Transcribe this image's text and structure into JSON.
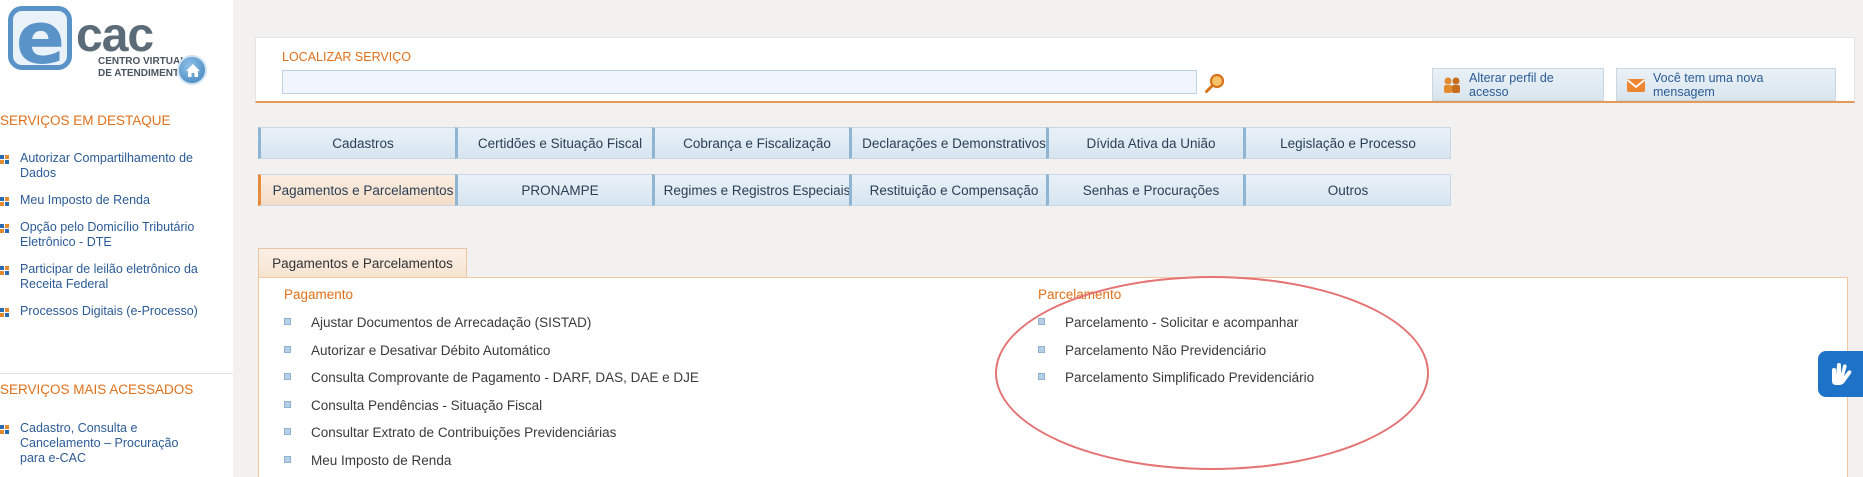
{
  "logo": {
    "brand": "cac",
    "subtitle_line1": "CENTRO VIRTUAL",
    "subtitle_line2": "DE ATENDIMENTO"
  },
  "sidebar": {
    "featured_title": "SERVIÇOS EM DESTAQUE",
    "featured_items": [
      "Autorizar Compartilhamento de Dados",
      "Meu Imposto de Renda",
      "Opção pelo Domicílio Tributário Eletrônico - DTE",
      "Participar de leilão eletrônico da Receita Federal",
      "Processos Digitais (e-Processo)"
    ],
    "most_accessed_title": "SERVIÇOS MAIS ACESSADOS",
    "most_accessed_items": [
      "Cadastro, Consulta e Cancelamento – Procuração para e-CAC"
    ]
  },
  "search": {
    "label": "LOCALIZAR SERVIÇO",
    "value": "",
    "placeholder": ""
  },
  "top_buttons": {
    "profile": "Alterar perfil de acesso",
    "message": "Você tem uma nova mensagem"
  },
  "categories": [
    "Cadastros",
    "Certidões e Situação Fiscal",
    "Cobrança e Fiscalização",
    "Declarações e Demonstrativos",
    "Dívida Ativa da União",
    "Legislação e Processo",
    "Pagamentos e Parcelamentos",
    "PRONAMPE",
    "Regimes e Registros Especiais",
    "Restituição e Compensação",
    "Senhas e Procurações",
    "Outros"
  ],
  "active_tab": "Pagamentos e Parcelamentos",
  "pagamento": {
    "title": "Pagamento",
    "items": [
      "Ajustar Documentos de Arrecadação (SISTAD)",
      "Autorizar e Desativar Débito Automático",
      "Consulta Comprovante de Pagamento - DARF, DAS, DAE e DJE",
      "Consulta Pendências - Situação Fiscal",
      "Consultar Extrato de Contribuições Previdenciárias",
      "Meu Imposto de Renda"
    ]
  },
  "parcelamento": {
    "title": "Parcelamento",
    "items": [
      "Parcelamento - Solicitar e acompanhar",
      "Parcelamento Não Previdenciário",
      "Parcelamento Simplificado Previdenciário"
    ]
  },
  "colors": {
    "accent_orange": "#e0701a",
    "link_blue": "#2b5b96",
    "annotation_red": "#e57373"
  }
}
